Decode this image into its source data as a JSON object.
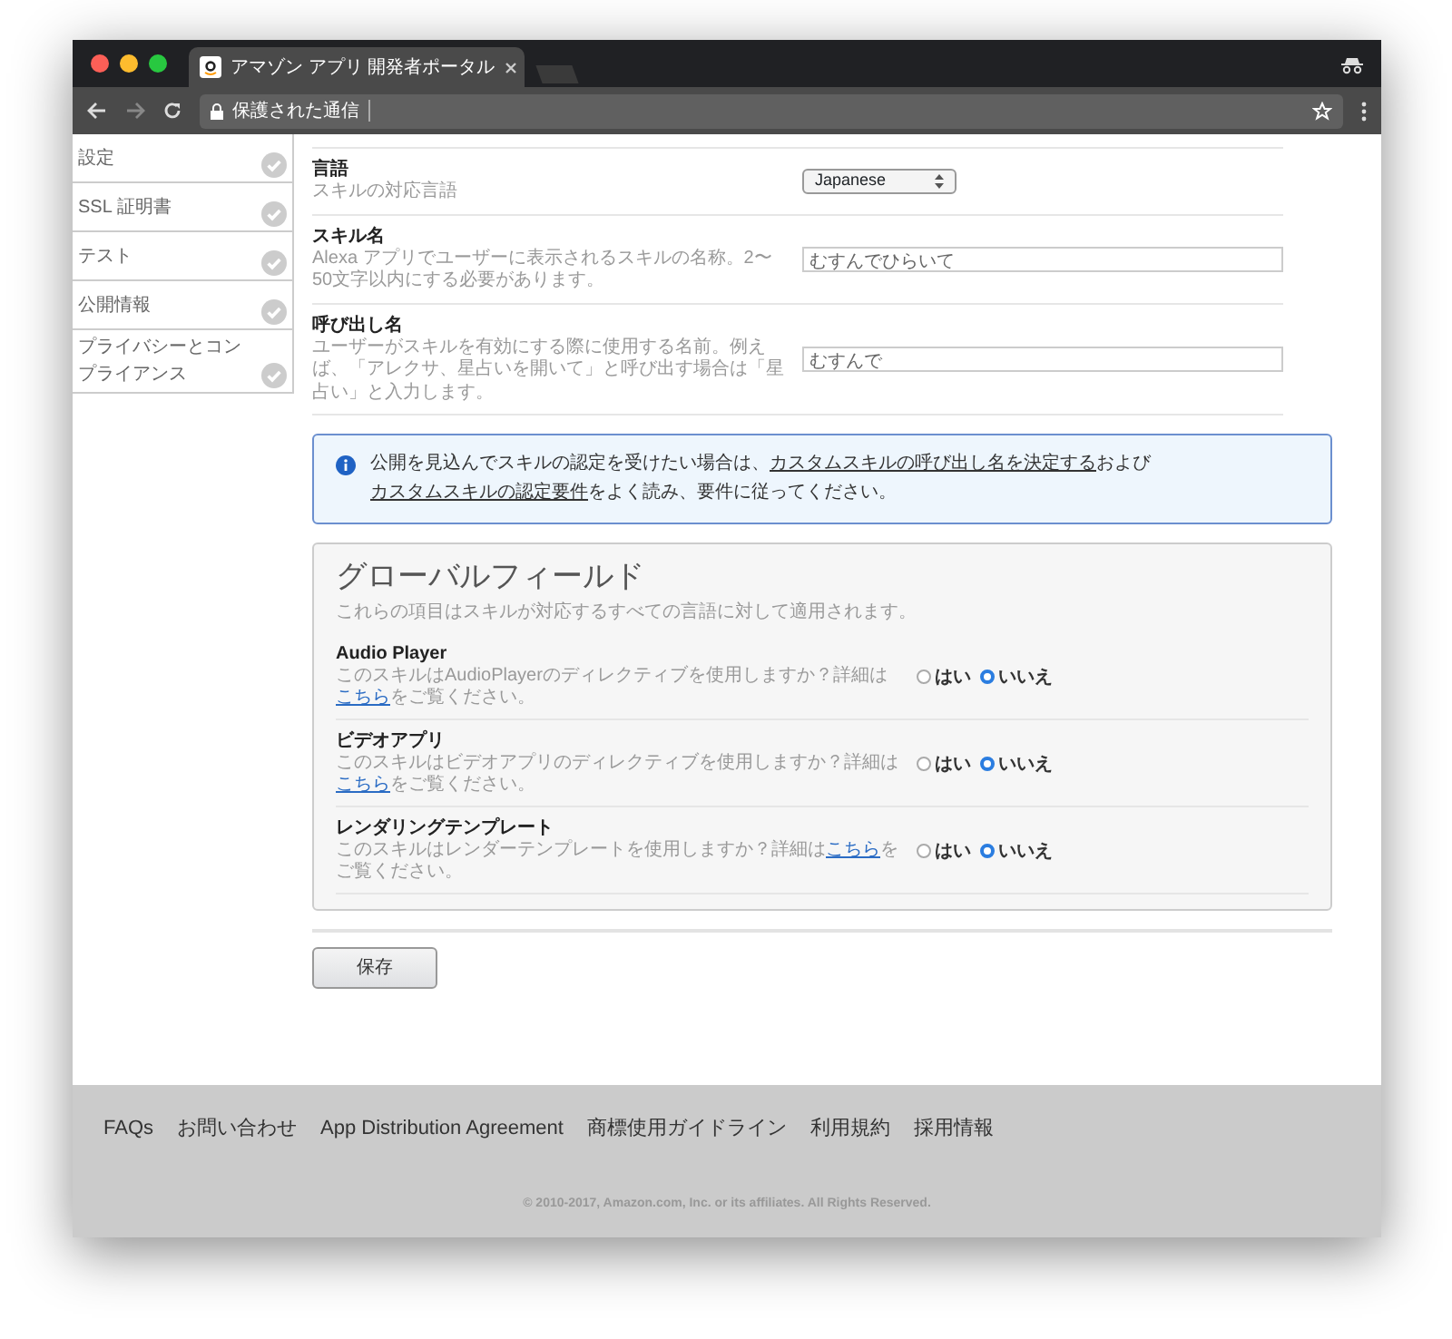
{
  "browser": {
    "tab_title": "アマゾン アプリ 開発者ポータル",
    "address": "保護された通信"
  },
  "sidebar": {
    "items": [
      {
        "label": "設定",
        "done": true
      },
      {
        "label": "SSL 証明書",
        "done": true
      },
      {
        "label": "テスト",
        "done": true
      },
      {
        "label": "公開情報",
        "done": true
      },
      {
        "label": "プライバシーとコンプライアンス",
        "done": true
      }
    ]
  },
  "skill_fields": [
    {
      "kind": "select",
      "label": "言語",
      "description": "スキルの対応言語",
      "value": "Japanese"
    },
    {
      "kind": "text",
      "label": "スキル名",
      "description": "Alexa アプリでユーザーに表示されるスキルの名称。2〜50文字以内にする必要があります。",
      "value": "むすんでひらいて"
    },
    {
      "kind": "text",
      "label": "呼び出し名",
      "description": "ユーザーがスキルを有効にする際に使用する名前。例えば、「アレクサ、星占いを開いて」と呼び出す場合は「星占い」と入力します。",
      "value": "むすんで"
    }
  ],
  "notice": {
    "segments": [
      {
        "kind": "text",
        "text": "公開を見込んでスキルの認定を受けたい場合は、"
      },
      {
        "kind": "link",
        "text": "カスタムスキルの呼び出し名を決定する"
      },
      {
        "kind": "text",
        "text": "および"
      },
      {
        "kind": "link",
        "text": "カスタムスキルの認定要件"
      },
      {
        "kind": "text",
        "text": "をよく読み、要件に従ってください。"
      }
    ]
  },
  "global_fields": {
    "title": "グローバルフィールド",
    "description": "これらの項目はスキルが対応するすべての言語に対して適用されます。",
    "items": [
      {
        "label": "Audio Player",
        "description": "このスキルはAudioPlayerのディレクティブを使用しますか？詳細は ",
        "link": "こちら",
        "description_end": "をご覧ください。",
        "options": [
          {
            "label": "はい",
            "selected": false
          },
          {
            "label": "いいえ",
            "selected": true
          }
        ]
      },
      {
        "label": "ビデオアプリ",
        "description": "このスキルはビデオアプリのディレクティブを使用しますか？詳細は",
        "link": "こちら",
        "description_end": "をご覧ください。",
        "options": [
          {
            "label": "はい",
            "selected": false
          },
          {
            "label": "いいえ",
            "selected": true
          }
        ]
      },
      {
        "label": "レンダリングテンプレート",
        "description": "このスキルはレンダーテンプレートを使用しますか？詳細は",
        "link": "こちら",
        "description_end": "をご覧ください。",
        "options": [
          {
            "label": "はい",
            "selected": false
          },
          {
            "label": "いいえ",
            "selected": true
          }
        ]
      }
    ]
  },
  "save_button": "保存",
  "footer": {
    "links": [
      "FAQs",
      "お問い合わせ",
      "App Distribution Agreement",
      "商標使用ガイドライン",
      "利用規約",
      "採用情報"
    ],
    "copyright": "© 2010-2017, Amazon.com, Inc. or its affiliates. All Rights Reserved."
  }
}
